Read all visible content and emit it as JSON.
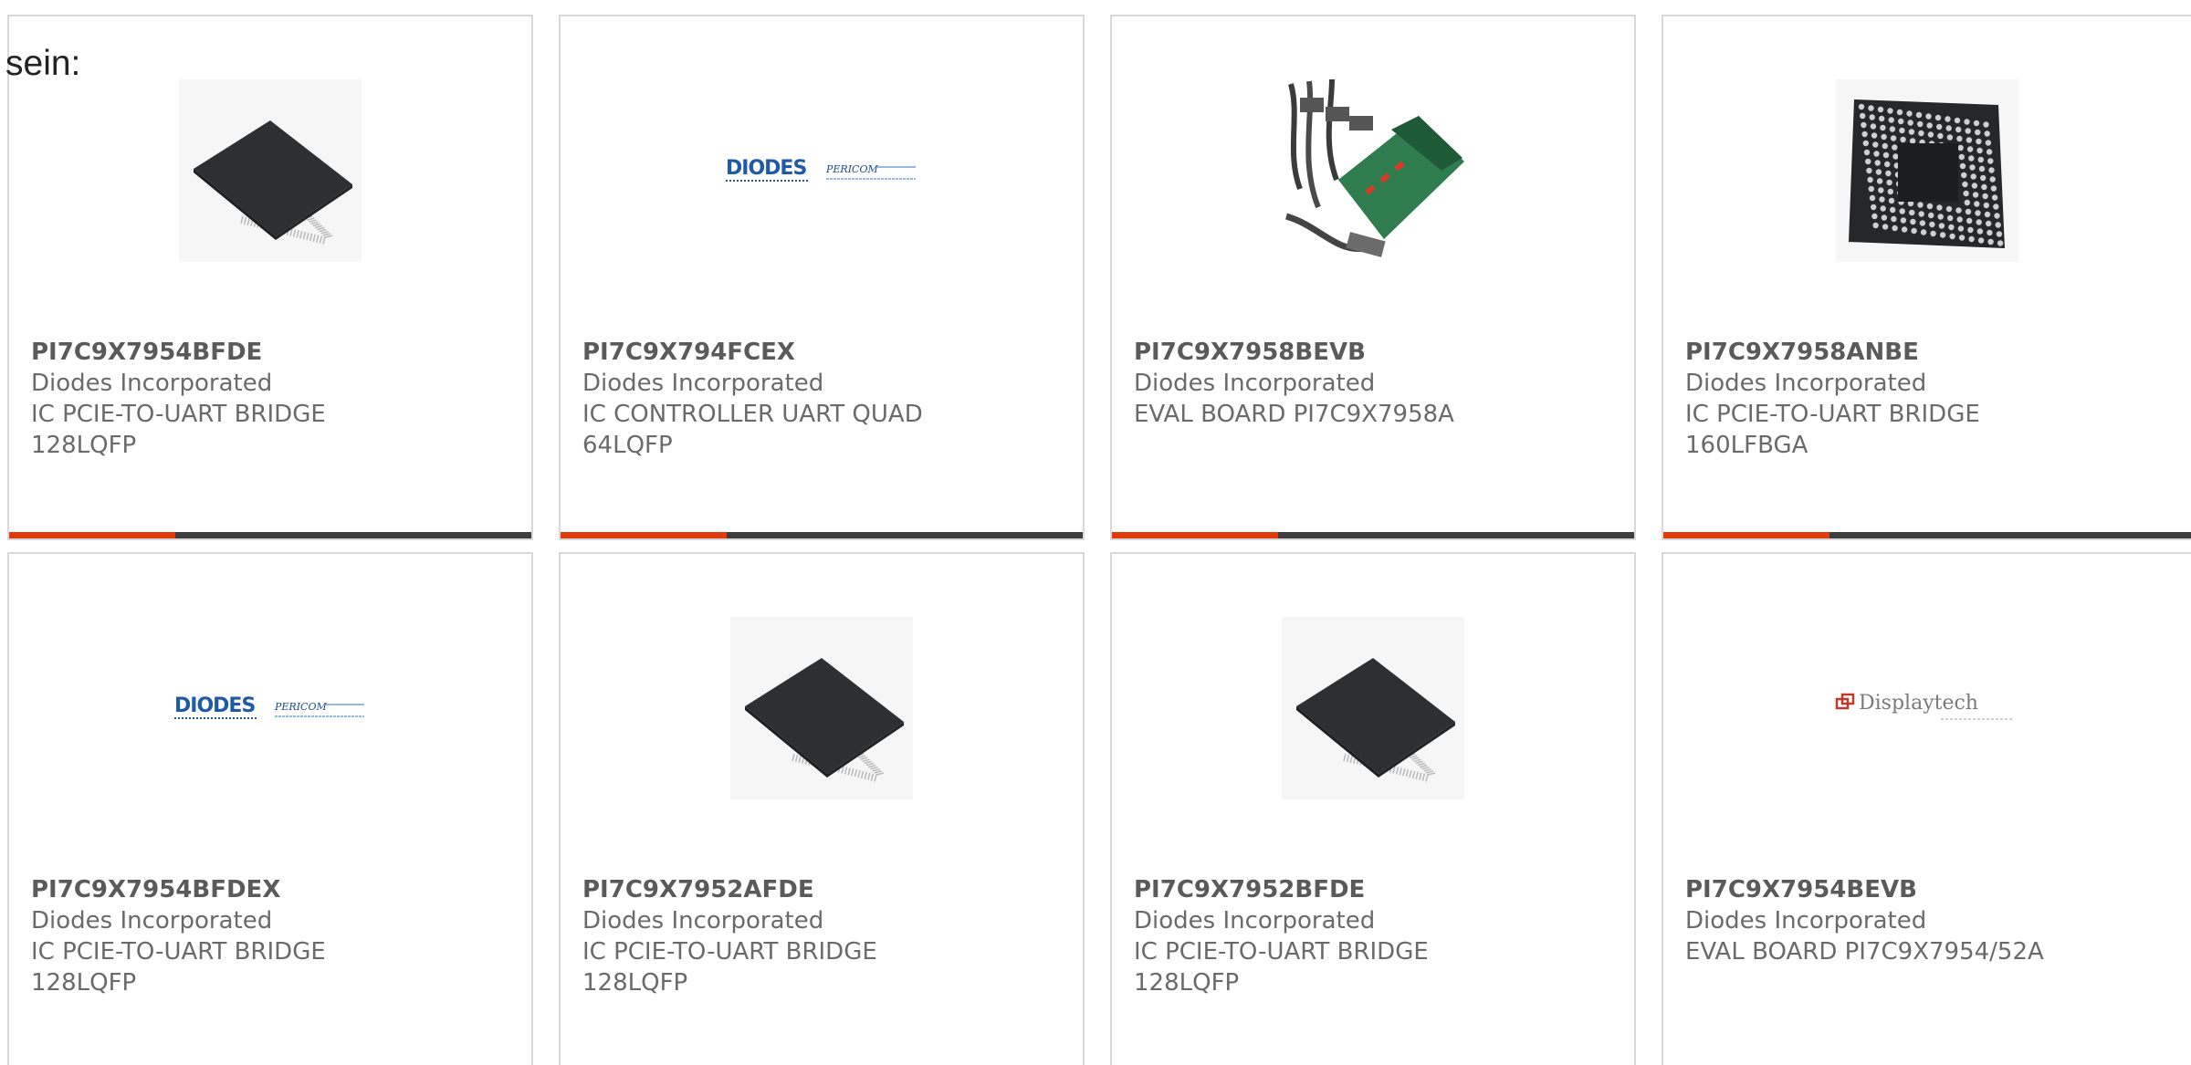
{
  "intro_text": "sein:",
  "colors": {
    "accent": "#e03c0b",
    "bar": "#3d3d3d",
    "diodes_blue": "#1f5aa6",
    "displaytech_red": "#c0392b"
  },
  "products": [
    {
      "part": "PI7C9X7954BFDE",
      "maker": "Diodes Incorporated",
      "desc1": "IC PCIE-TO-UART BRIDGE",
      "desc2": "128LQFP",
      "image": "qfp-chip"
    },
    {
      "part": "PI7C9X794FCEX",
      "maker": "Diodes Incorporated",
      "desc1": "IC CONTROLLER UART QUAD",
      "desc2": "64LQFP",
      "image": "diodes-logo"
    },
    {
      "part": "PI7C9X7958BEVB",
      "maker": "Diodes Incorporated",
      "desc1": "EVAL BOARD PI7C9X7958A",
      "desc2": "",
      "image": "eval-board"
    },
    {
      "part": "PI7C9X7958ANBE",
      "maker": "Diodes Incorporated",
      "desc1": "IC PCIE-TO-UART BRIDGE",
      "desc2": "160LFBGA",
      "image": "bga-chip"
    },
    {
      "part": "PI7C9X7954BFDEX",
      "maker": "Diodes Incorporated",
      "desc1": "IC PCIE-TO-UART BRIDGE",
      "desc2": "128LQFP",
      "image": "diodes-logo"
    },
    {
      "part": "PI7C9X7952AFDE",
      "maker": "Diodes Incorporated",
      "desc1": "IC PCIE-TO-UART BRIDGE",
      "desc2": "128LQFP",
      "image": "qfp-chip"
    },
    {
      "part": "PI7C9X7952BFDE",
      "maker": "Diodes Incorporated",
      "desc1": "IC PCIE-TO-UART BRIDGE",
      "desc2": "128LQFP",
      "image": "qfp-chip"
    },
    {
      "part": "PI7C9X7954BEVB",
      "maker": "Diodes Incorporated",
      "desc1": "EVAL BOARD PI7C9X7954/52A",
      "desc2": "",
      "image": "displaytech-logo"
    }
  ],
  "logos": {
    "diodes": "DIODES",
    "pericom": "PERICOM",
    "displaytech": "Displaytech"
  }
}
